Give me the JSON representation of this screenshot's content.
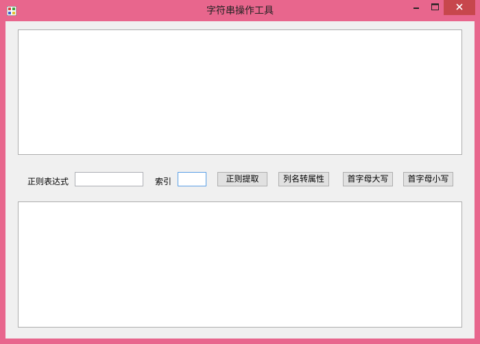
{
  "window": {
    "title": "字符串操作工具",
    "controls": {
      "minimize": "−",
      "maximize": "□",
      "close": "✕"
    }
  },
  "toolbar": {
    "regex_label": "正则表达式",
    "regex_value": "",
    "index_label": "索引",
    "index_value": "",
    "buttons": {
      "regex_extract": "正则提取",
      "column_to_property": "列名转属性",
      "capitalize_first": "首字母大写",
      "lowercase_first": "首字母小写"
    }
  },
  "input_text": "",
  "output_text": ""
}
